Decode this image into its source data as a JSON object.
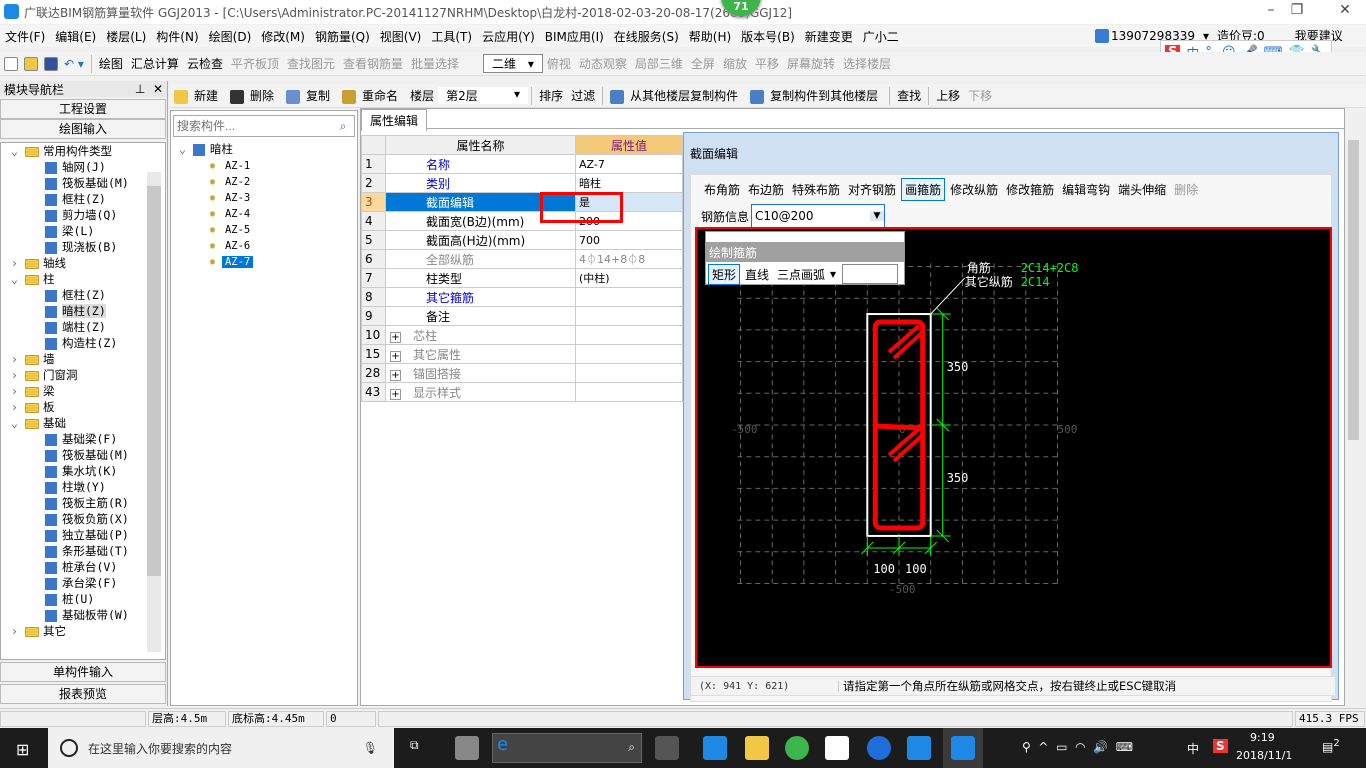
{
  "title": "广联达BIM钢筋算量软件 GGJ2013 - [C:\\Users\\Administrator.PC-20141127NRHM\\Desktop\\白龙村-2018-02-03-20-08-17(2668)GGJ12]",
  "badge": "71",
  "menu": [
    "文件(F)",
    "编辑(E)",
    "楼层(L)",
    "构件(N)",
    "绘图(D)",
    "修改(M)",
    "钢筋量(Q)",
    "视图(V)",
    "工具(T)",
    "云应用(Y)",
    "BIM应用(I)",
    "在线服务(S)",
    "帮助(H)",
    "版本号(B)",
    "新建变更",
    "广小二"
  ],
  "account": {
    "phone": "13907298339",
    "beans": "造价豆:0",
    "suggest": "我要建议"
  },
  "toolbar1": {
    "items": [
      "绘图",
      "汇总计算",
      "云检查"
    ],
    "disabled": [
      "平齐板顶",
      "查找图元",
      "查看钢筋量",
      "批量选择"
    ],
    "view_select": "二维",
    "view_items": [
      "俯视",
      "动态观察",
      "局部三维",
      "全屏",
      "缩放",
      "平移",
      "屏幕旋转",
      "选择楼层"
    ]
  },
  "toolbar2": {
    "new": "新建",
    "delete": "删除",
    "copy": "复制",
    "rename": "重命名",
    "floor_label": "楼层",
    "floor_value": "第2层",
    "sort": "排序",
    "filter": "过滤",
    "copy_from": "从其他楼层复制构件",
    "copy_to": "复制构件到其他楼层",
    "find": "查找",
    "up": "上移",
    "down": "下移"
  },
  "nav": {
    "header": "模块导航栏",
    "btn_project": "工程设置",
    "btn_draw": "绘图输入",
    "btn_single": "单构件输入",
    "btn_report": "报表预览",
    "tree": [
      {
        "level": 0,
        "label": "常用构件类型",
        "folder": true,
        "open": true
      },
      {
        "level": 1,
        "label": "轴网(J)"
      },
      {
        "level": 1,
        "label": "筏板基础(M)"
      },
      {
        "level": 1,
        "label": "框柱(Z)"
      },
      {
        "level": 1,
        "label": "剪力墙(Q)"
      },
      {
        "level": 1,
        "label": "梁(L)"
      },
      {
        "level": 1,
        "label": "现浇板(B)"
      },
      {
        "level": 0,
        "label": "轴线",
        "folder": true
      },
      {
        "level": 0,
        "label": "柱",
        "folder": true,
        "open": true
      },
      {
        "level": 1,
        "label": "框柱(Z)"
      },
      {
        "level": 1,
        "label": "暗柱(Z)",
        "selected": true
      },
      {
        "level": 1,
        "label": "端柱(Z)"
      },
      {
        "level": 1,
        "label": "构造柱(Z)"
      },
      {
        "level": 0,
        "label": "墙",
        "folder": true
      },
      {
        "level": 0,
        "label": "门窗洞",
        "folder": true
      },
      {
        "level": 0,
        "label": "梁",
        "folder": true
      },
      {
        "level": 0,
        "label": "板",
        "folder": true
      },
      {
        "level": 0,
        "label": "基础",
        "folder": true,
        "open": true
      },
      {
        "level": 1,
        "label": "基础梁(F)"
      },
      {
        "level": 1,
        "label": "筏板基础(M)"
      },
      {
        "level": 1,
        "label": "集水坑(K)"
      },
      {
        "level": 1,
        "label": "柱墩(Y)"
      },
      {
        "level": 1,
        "label": "筏板主筋(R)"
      },
      {
        "level": 1,
        "label": "筏板负筋(X)"
      },
      {
        "level": 1,
        "label": "独立基础(P)"
      },
      {
        "level": 1,
        "label": "条形基础(T)"
      },
      {
        "level": 1,
        "label": "桩承台(V)"
      },
      {
        "level": 1,
        "label": "承台梁(F)"
      },
      {
        "level": 1,
        "label": "桩(U)"
      },
      {
        "level": 1,
        "label": "基础板带(W)"
      },
      {
        "level": 0,
        "label": "其它",
        "folder": true
      }
    ]
  },
  "components": {
    "search_placeholder": "搜索构件...",
    "root": "暗柱",
    "items": [
      "AZ-1",
      "AZ-2",
      "AZ-3",
      "AZ-4",
      "AZ-5",
      "AZ-6",
      "AZ-7"
    ],
    "selected": "AZ-7"
  },
  "property": {
    "tab": "属性编辑",
    "col_name": "属性名称",
    "col_value": "属性值",
    "rows": [
      {
        "n": "1",
        "name": "名称",
        "value": "AZ-7",
        "style": "blue"
      },
      {
        "n": "2",
        "name": "类别",
        "value": "暗柱",
        "style": "blue"
      },
      {
        "n": "3",
        "name": "截面编辑",
        "value": "是",
        "style": "selected"
      },
      {
        "n": "4",
        "name": "截面宽(B边)(mm)",
        "value": "200",
        "style": ""
      },
      {
        "n": "5",
        "name": "截面高(H边)(mm)",
        "value": "700",
        "style": ""
      },
      {
        "n": "6",
        "name": "全部纵筋",
        "value": "4⏀14+8⏀8",
        "style": "gray"
      },
      {
        "n": "7",
        "name": "柱类型",
        "value": "(中柱)",
        "style": ""
      },
      {
        "n": "8",
        "name": "其它箍筋",
        "value": "",
        "style": "blue"
      },
      {
        "n": "9",
        "name": "备注",
        "value": "",
        "style": ""
      },
      {
        "n": "10",
        "name": "芯柱",
        "value": "",
        "style": "group"
      },
      {
        "n": "15",
        "name": "其它属性",
        "value": "",
        "style": "group"
      },
      {
        "n": "28",
        "name": "锚固搭接",
        "value": "",
        "style": "group"
      },
      {
        "n": "43",
        "name": "显示样式",
        "value": "",
        "style": "group"
      }
    ]
  },
  "section_editor": {
    "title": "截面编辑",
    "tools": [
      "布角筋",
      "布边筋",
      "特殊布筋",
      "对齐钢筋",
      "画箍筋",
      "修改纵筋",
      "修改箍筋",
      "编辑弯钩",
      "端头伸缩",
      "删除"
    ],
    "active_tool": "画箍筋",
    "rebar_label": "钢筋信息",
    "rebar_value": "C10@200",
    "draw_panel": {
      "title": "绘制箍筋",
      "tools": [
        "矩形",
        "直线",
        "三点画弧"
      ],
      "active": "矩形"
    },
    "labels": {
      "corner": "角筋",
      "corner_val": "2C14+2C8",
      "other": "其它纵筋",
      "other_val": "2C14",
      "dim_h1": "350",
      "dim_h2": "350",
      "dim_w1": "100",
      "dim_w2": "100",
      "axis_left": "-500",
      "axis_right": "500",
      "axis_bottom": "-500",
      "axis_center": "0",
      "axis_top": "0"
    },
    "coords": "(X: 941 Y: 621)",
    "hint": "请指定第一个角点所在纵筋或网格交点，按右键终止或ESC键取消"
  },
  "status": {
    "floor_height": "层高:4.5m",
    "base_height": "底标高:4.45m",
    "num": "0",
    "fps": "415.3 FPS"
  },
  "taskbar": {
    "search_placeholder": "在这里输入你要搜索的内容",
    "time": "9:19",
    "date": "2018/11/1",
    "ime": "中",
    "notif": "2"
  },
  "colors": {
    "accent": "#0078d7",
    "canvas_bg": "#000000",
    "rebar": "#ff0000",
    "dimension": "#00ff00"
  }
}
